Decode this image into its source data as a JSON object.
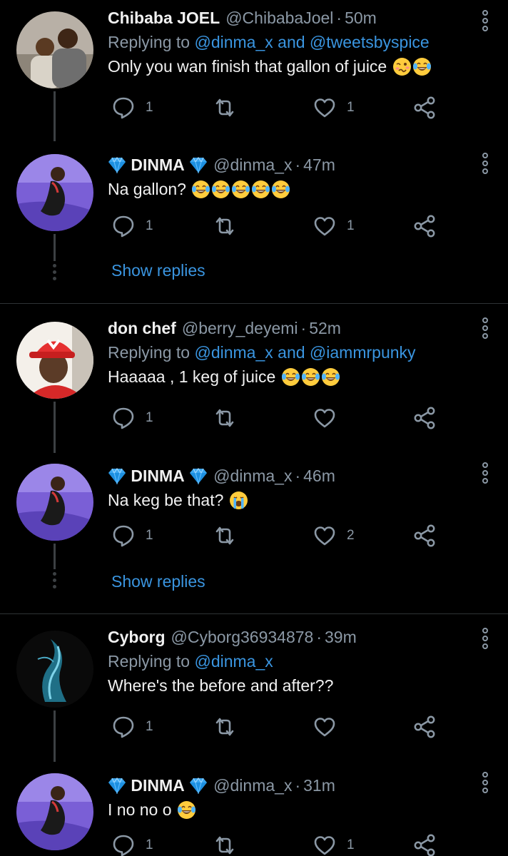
{
  "colors": {
    "background": "#000000",
    "link": "#3a95e0",
    "muted": "#8b98a5",
    "text": "#f1f1f1"
  },
  "threads": [
    {
      "parent": {
        "name": "Chibaba JOEL",
        "handle": "@ChibabaJoel",
        "time": "50m",
        "replying_label": "Replying to",
        "mentions": [
          "@dinma_x",
          "@tweetsbyspice"
        ],
        "mention_joiner": "and",
        "text": "Only you wan finish that gallon of juice",
        "emojis": [
          "woozy-face",
          "joy-face"
        ],
        "reply_count": "1",
        "like_count": "1"
      },
      "reply": {
        "name": "DINMA",
        "handle": "@dinma_x",
        "time": "47m",
        "text": "Na gallon?",
        "emojis": [
          "joy-face",
          "joy-face",
          "joy-face",
          "joy-face",
          "joy-face"
        ],
        "reply_count": "1",
        "like_count": "1"
      },
      "show_replies": "Show replies"
    },
    {
      "parent": {
        "name": "don chef",
        "handle": "@berry_deyemi",
        "time": "52m",
        "replying_label": "Replying to",
        "mentions": [
          "@dinma_x",
          "@iammrpunky"
        ],
        "mention_joiner": "and",
        "text": "Haaaaa , 1 keg of juice",
        "emojis": [
          "joy-face",
          "joy-face",
          "joy-face"
        ],
        "reply_count": "1",
        "like_count": ""
      },
      "reply": {
        "name": "DINMA",
        "handle": "@dinma_x",
        "time": "46m",
        "text": "Na keg be that?",
        "emojis": [
          "loudly-crying-face"
        ],
        "reply_count": "1",
        "like_count": "2"
      },
      "show_replies": "Show replies"
    },
    {
      "parent": {
        "name": "Cyborg",
        "handle": "@Cyborg36934878",
        "time": "39m",
        "replying_label": "Replying to",
        "mentions": [
          "@dinma_x"
        ],
        "text": "Where's the before and after??",
        "emojis": [],
        "reply_count": "1",
        "like_count": ""
      },
      "reply": {
        "name": "DINMA",
        "handle": "@dinma_x",
        "time": "31m",
        "text": "I no no o",
        "emojis": [
          "joy-face"
        ],
        "reply_count": "1",
        "like_count": "1"
      }
    }
  ],
  "separator_dot": "·",
  "icons": [
    "reply-icon",
    "retweet-icon",
    "like-icon",
    "share-icon",
    "more-options-icon",
    "diamond-icon"
  ]
}
